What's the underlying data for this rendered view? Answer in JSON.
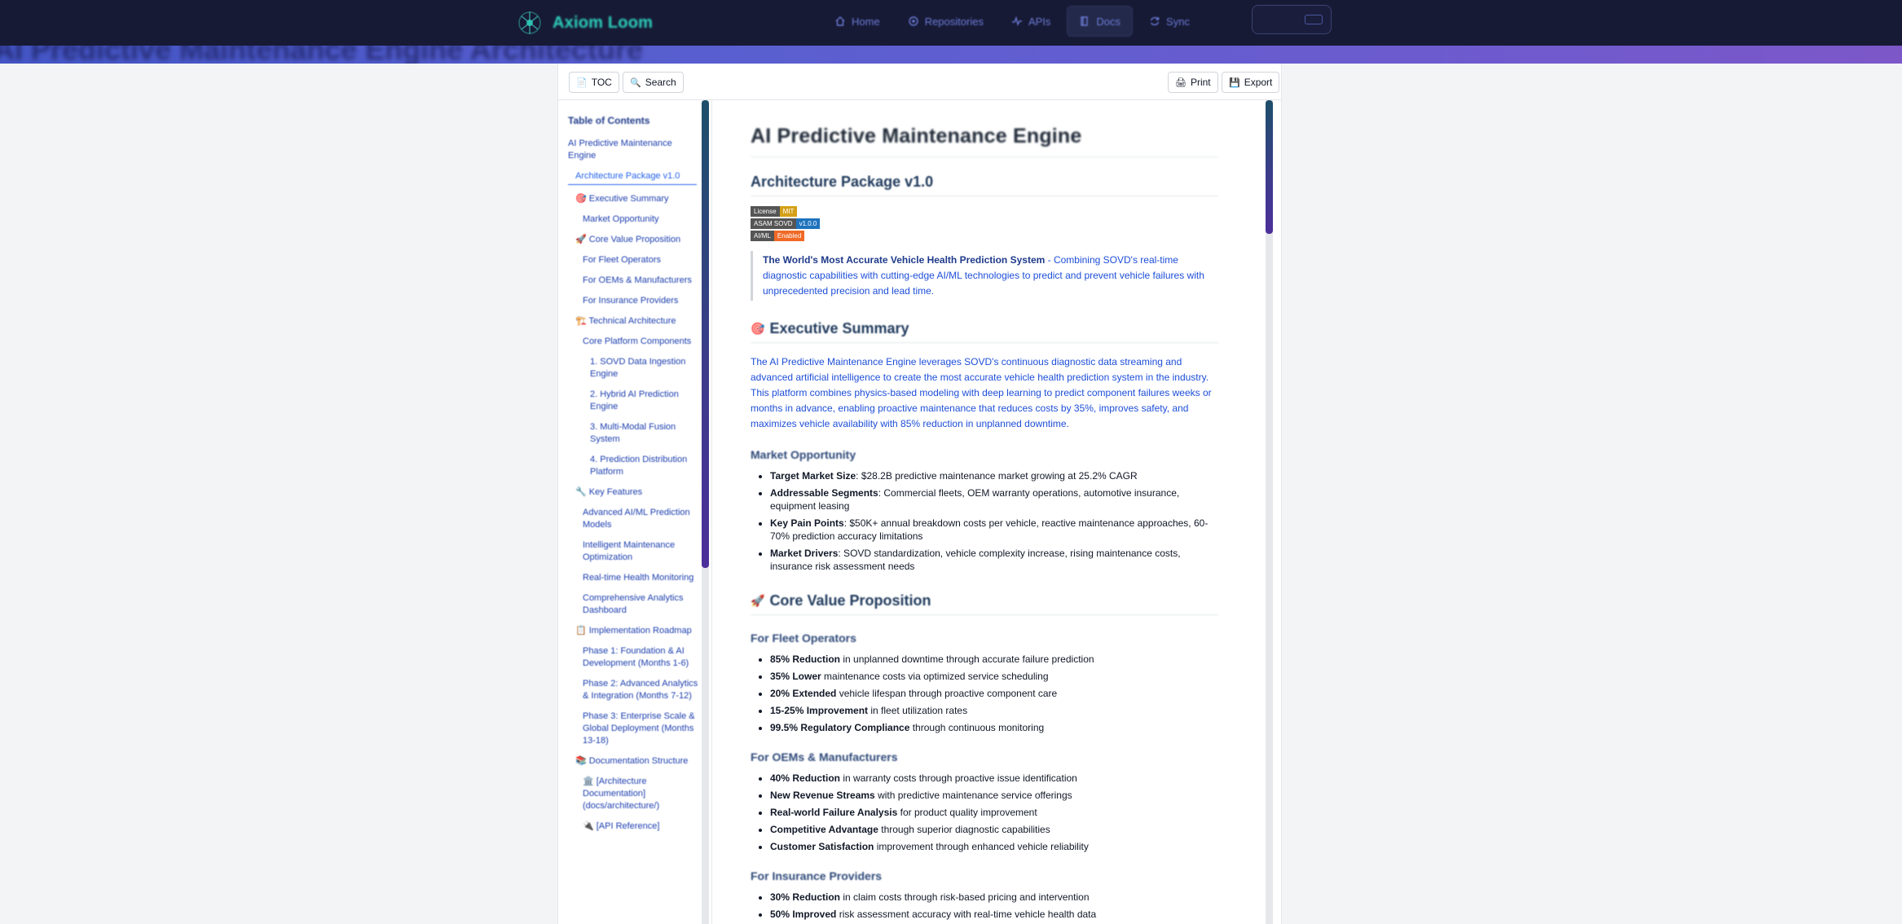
{
  "nav": {
    "brand": "Axiom Loom",
    "links": [
      {
        "label": "Home",
        "icon": "home-icon",
        "active": false
      },
      {
        "label": "Repositories",
        "icon": "repository-icon",
        "active": false
      },
      {
        "label": "APIs",
        "icon": "pulse-icon",
        "active": false
      },
      {
        "label": "Docs",
        "icon": "book-icon",
        "active": true
      },
      {
        "label": "Sync",
        "icon": "sync-icon",
        "active": false
      }
    ]
  },
  "hero": {
    "title": "AI Predictive Maintenance Engine Architecture"
  },
  "toolbar": {
    "toc": "TOC",
    "search": "Search",
    "print": "Print",
    "export": "Export"
  },
  "toc": {
    "title": "Table of Contents",
    "items": [
      {
        "label": "AI Predictive Maintenance Engine"
      },
      {
        "label": "Architecture Package v1.0"
      },
      {
        "label": "🎯 Executive Summary"
      },
      {
        "label": "Market Opportunity"
      },
      {
        "label": "🚀 Core Value Proposition"
      },
      {
        "label": "For Fleet Operators"
      },
      {
        "label": "For OEMs & Manufacturers"
      },
      {
        "label": "For Insurance Providers"
      },
      {
        "label": "🏗️ Technical Architecture"
      },
      {
        "label": "Core Platform Components"
      },
      {
        "label": "1. SOVD Data Ingestion Engine"
      },
      {
        "label": "2. Hybrid AI Prediction Engine"
      },
      {
        "label": "3. Multi-Modal Fusion System"
      },
      {
        "label": "4. Prediction Distribution Platform"
      },
      {
        "label": "🔧 Key Features"
      },
      {
        "label": "Advanced AI/ML Prediction Models"
      },
      {
        "label": "Intelligent Maintenance Optimization"
      },
      {
        "label": "Real-time Health Monitoring"
      },
      {
        "label": "Comprehensive Analytics Dashboard"
      },
      {
        "label": "📋 Implementation Roadmap"
      },
      {
        "label": "Phase 1: Foundation & AI Development (Months 1-6)"
      },
      {
        "label": "Phase 2: Advanced Analytics & Integration (Months 7-12)"
      },
      {
        "label": "Phase 3: Enterprise Scale & Global Deployment (Months 13-18)"
      },
      {
        "label": "📚 Documentation Structure"
      },
      {
        "label": "🏛️ [Architecture Documentation](docs/architecture/)"
      },
      {
        "label": "🔌 [API Reference]"
      }
    ]
  },
  "doc": {
    "title": "AI Predictive Maintenance Engine",
    "subtitle": "Architecture Package v1.0",
    "badges": [
      {
        "key": "License",
        "value": "MIT",
        "color": "#d4a017"
      },
      {
        "key": "ASAM SOVD",
        "value": "v1.0.0",
        "color": "#1e73be"
      },
      {
        "key": "AI/ML",
        "value": "Enabled",
        "color": "#f06a26"
      }
    ],
    "callout": {
      "strong": "The World's Most Accurate Vehicle Health Prediction System",
      "rest": " - Combining SOVD's real-time diagnostic capabilities with cutting-edge AI/ML technologies to predict and prevent vehicle failures with unprecedented precision and lead time."
    },
    "exec": {
      "heading": "Executive Summary",
      "emoji": "🎯",
      "body": "The AI Predictive Maintenance Engine leverages SOVD's continuous diagnostic data streaming and advanced artificial intelligence to create the most accurate vehicle health prediction system in the industry. This platform combines physics-based modeling with deep learning to predict component failures weeks or months in advance, enabling proactive maintenance that reduces costs by 35%, improves safety, and maximizes vehicle availability with 85% reduction in unplanned downtime."
    },
    "market": {
      "heading": "Market Opportunity",
      "items": [
        {
          "b": "Target Market Size",
          "t": ": $28.2B predictive maintenance market growing at 25.2% CAGR"
        },
        {
          "b": "Addressable Segments",
          "t": ": Commercial fleets, OEM warranty operations, automotive insurance, equipment leasing"
        },
        {
          "b": "Key Pain Points",
          "t": ": $50K+ annual breakdown costs per vehicle, reactive maintenance approaches, 60-70% prediction accuracy limitations"
        },
        {
          "b": "Market Drivers",
          "t": ": SOVD standardization, vehicle complexity increase, rising maintenance costs, insurance risk assessment needs"
        }
      ]
    },
    "value": {
      "heading": "Core Value Proposition",
      "emoji": "🚀"
    },
    "fleet": {
      "heading": "For Fleet Operators",
      "items": [
        {
          "b": "85% Reduction",
          "t": " in unplanned downtime through accurate failure prediction"
        },
        {
          "b": "35% Lower",
          "t": " maintenance costs via optimized service scheduling"
        },
        {
          "b": "20% Extended",
          "t": " vehicle lifespan through proactive component care"
        },
        {
          "b": "15-25% Improvement",
          "t": " in fleet utilization rates"
        },
        {
          "b": "99.5% Regulatory Compliance",
          "t": " through continuous monitoring"
        }
      ]
    },
    "oem": {
      "heading": "For OEMs & Manufacturers",
      "items": [
        {
          "b": "40% Reduction",
          "t": " in warranty costs through proactive issue identification"
        },
        {
          "b": "New Revenue Streams",
          "t": " with predictive maintenance service offerings"
        },
        {
          "b": "Real-world Failure Analysis",
          "t": " for product quality improvement"
        },
        {
          "b": "Competitive Advantage",
          "t": " through superior diagnostic capabilities"
        },
        {
          "b": "Customer Satisfaction",
          "t": " improvement through enhanced vehicle reliability"
        }
      ]
    },
    "insurance": {
      "heading": "For Insurance Providers",
      "items": [
        {
          "b": "30% Reduction",
          "t": " in claim costs through risk-based pricing and intervention"
        },
        {
          "b": "50% Improved",
          "t": " risk assessment accuracy with real-time vehicle health data"
        }
      ]
    }
  }
}
